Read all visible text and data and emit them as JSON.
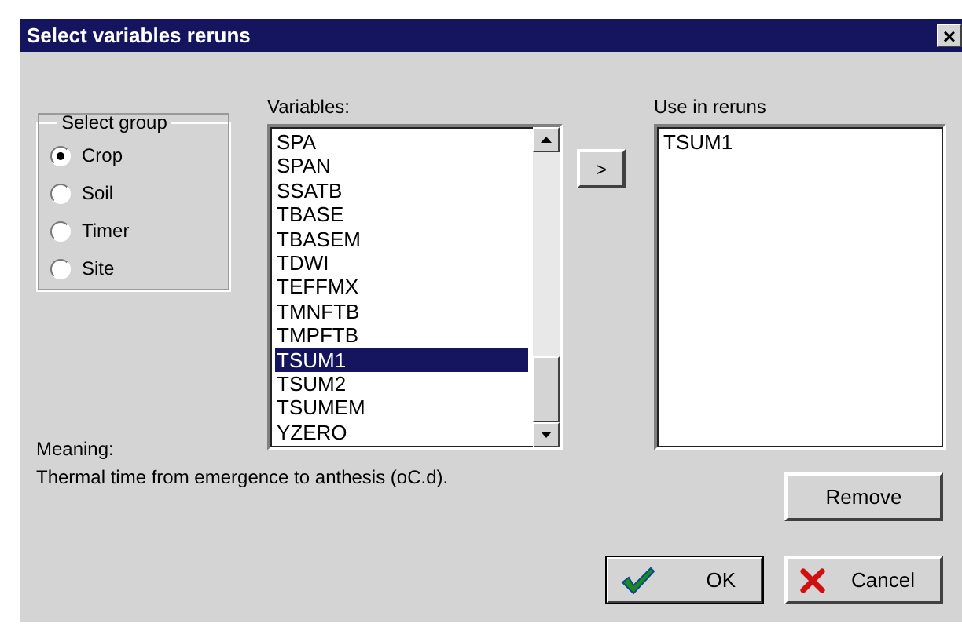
{
  "window": {
    "title": "Select variables reruns",
    "close": "×"
  },
  "group": {
    "title": "Select group",
    "options": [
      {
        "label": "Crop",
        "selected": true
      },
      {
        "label": "Soil",
        "selected": false
      },
      {
        "label": "Timer",
        "selected": false
      },
      {
        "label": "Site",
        "selected": false
      }
    ]
  },
  "variables": {
    "label": "Variables:",
    "items": [
      {
        "name": "SPA",
        "selected": false
      },
      {
        "name": "SPAN",
        "selected": false
      },
      {
        "name": "SSATB",
        "selected": false
      },
      {
        "name": "TBASE",
        "selected": false
      },
      {
        "name": "TBASEM",
        "selected": false
      },
      {
        "name": "TDWI",
        "selected": false
      },
      {
        "name": "TEFFMX",
        "selected": false
      },
      {
        "name": "TMNFTB",
        "selected": false
      },
      {
        "name": "TMPFTB",
        "selected": false
      },
      {
        "name": "TSUM1",
        "selected": true
      },
      {
        "name": "TSUM2",
        "selected": false
      },
      {
        "name": "TSUMEM",
        "selected": false
      },
      {
        "name": "YZERO",
        "selected": false
      }
    ]
  },
  "add_button": ">",
  "reruns": {
    "label": "Use in reruns",
    "items": [
      "TSUM1"
    ]
  },
  "meaning": {
    "label": "Meaning:",
    "text": "Thermal time from emergence to anthesis (oC.d)."
  },
  "buttons": [
    {
      "kind": "remove",
      "label": "Remove"
    },
    {
      "kind": "ok",
      "label": "OK"
    },
    {
      "kind": "cancel",
      "label": "Cancel"
    }
  ]
}
